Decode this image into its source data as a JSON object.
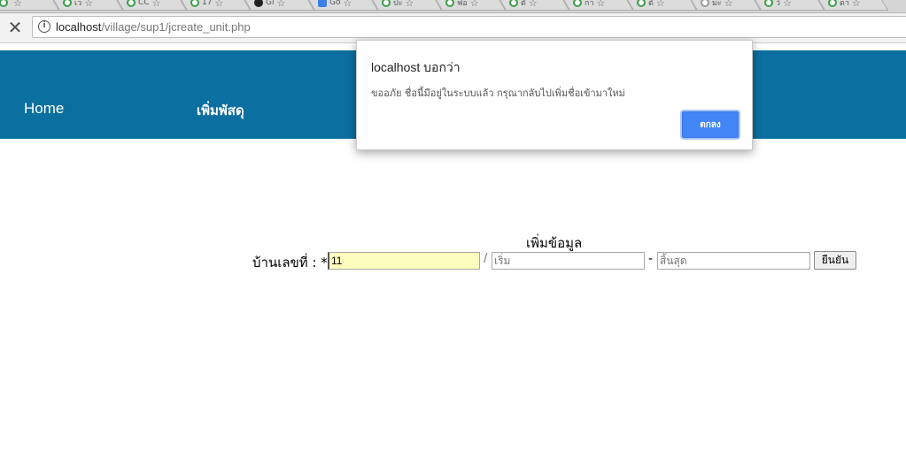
{
  "browser": {
    "tabs": [
      {
        "label": "",
        "icon": "tab-favicon-icon"
      },
      {
        "label": "เว",
        "icon": "green-circle-favicon-icon"
      },
      {
        "label": "CC",
        "icon": "tab-favicon-icon"
      },
      {
        "label": "17",
        "icon": "tab-favicon-icon"
      },
      {
        "label": "Gi",
        "icon": "github-icon"
      },
      {
        "label": "Go",
        "icon": "blue-square-favicon-icon"
      },
      {
        "label": "ปะ",
        "icon": "tab-favicon-icon"
      },
      {
        "label": "ฟอ",
        "icon": "tab-favicon-icon"
      },
      {
        "label": "ตั",
        "icon": "tab-favicon-icon"
      },
      {
        "label": "กา",
        "icon": "tab-favicon-icon"
      },
      {
        "label": "ตั",
        "icon": "green-circle-favicon-icon"
      },
      {
        "label": "มะ",
        "icon": "gray-circle-favicon-icon"
      },
      {
        "label": "วิ",
        "icon": "tab-favicon-icon"
      },
      {
        "label": "ดา",
        "icon": "tab-favicon-icon"
      }
    ],
    "url_host": "localhost",
    "url_path": "/village/sup1/jcreate_unit.php"
  },
  "nav": {
    "home": "Home",
    "add_item": "เพิ่มพัสดุ",
    "color": "#0b6f9f"
  },
  "form": {
    "title": "เพิ่มข้อมูล",
    "house_label": "บ้านเลขที่ : *",
    "house_value": "11",
    "slash": "/",
    "start_placeholder": "เริ่ม",
    "dash": "-",
    "end_placeholder": "สิ้นสุด",
    "submit": "ยืนยัน"
  },
  "dialog": {
    "title": "localhost บอกว่า",
    "message": "ขออภัย ชื่อนี้มีอยู่ในระบบแล้ว กรุณากลับไปเพิ่มชื่อเข้ามาใหม่",
    "ok": "ตกลง",
    "ok_color": "#4285f4"
  }
}
